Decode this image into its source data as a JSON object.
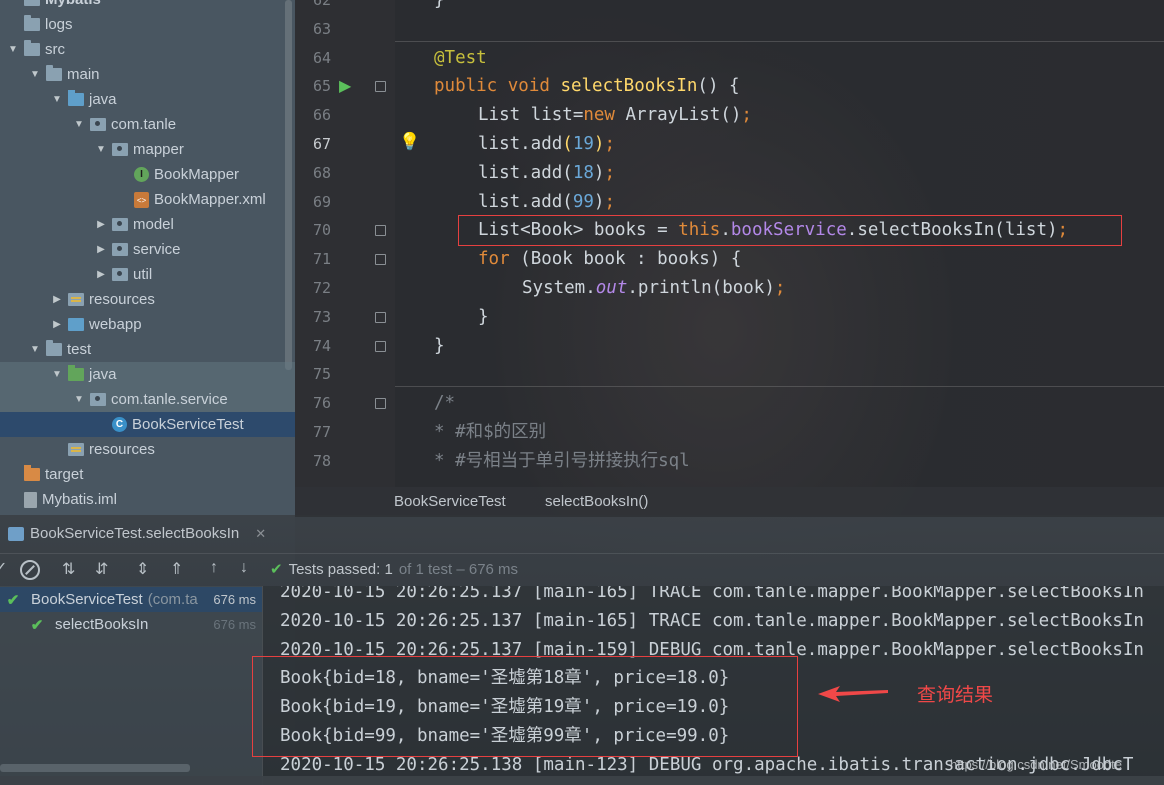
{
  "project_tree": {
    "items": [
      {
        "label": "Mybatis",
        "depth": 0,
        "icon": "folder",
        "arrow": "",
        "bold": true
      },
      {
        "label": "logs",
        "depth": 0,
        "icon": "folder",
        "arrow": ""
      },
      {
        "label": "src",
        "depth": 0,
        "icon": "folder",
        "arrow": "▼"
      },
      {
        "label": "main",
        "depth": 1,
        "icon": "folder",
        "arrow": "▼"
      },
      {
        "label": "java",
        "depth": 2,
        "icon": "src",
        "arrow": "▼"
      },
      {
        "label": "com.tanle",
        "depth": 3,
        "icon": "pkg",
        "arrow": "▼"
      },
      {
        "label": "mapper",
        "depth": 4,
        "icon": "pkg",
        "arrow": "▼"
      },
      {
        "label": "BookMapper",
        "depth": 5,
        "icon": "iface",
        "arrow": ""
      },
      {
        "label": "BookMapper.xml",
        "depth": 5,
        "icon": "xml",
        "arrow": ""
      },
      {
        "label": "model",
        "depth": 4,
        "icon": "pkg",
        "arrow": "▶"
      },
      {
        "label": "service",
        "depth": 4,
        "icon": "pkg",
        "arrow": "▶"
      },
      {
        "label": "util",
        "depth": 4,
        "icon": "pkg",
        "arrow": "▶"
      },
      {
        "label": "resources",
        "depth": 2,
        "icon": "res",
        "arrow": "▶"
      },
      {
        "label": "webapp",
        "depth": 2,
        "icon": "web",
        "arrow": "▶"
      },
      {
        "label": "test",
        "depth": 1,
        "icon": "folder",
        "arrow": "▼"
      },
      {
        "label": "java",
        "depth": 2,
        "icon": "test",
        "arrow": "▼"
      },
      {
        "label": "com.tanle.service",
        "depth": 3,
        "icon": "pkg",
        "arrow": "▼"
      },
      {
        "label": "BookServiceTest",
        "depth": 4,
        "icon": "testclass",
        "arrow": "",
        "selected": true
      },
      {
        "label": "resources",
        "depth": 2,
        "icon": "res",
        "arrow": ""
      },
      {
        "label": "target",
        "depth": 0,
        "icon": "target",
        "arrow": ""
      },
      {
        "label": "Mybatis.iml",
        "depth": 0,
        "icon": "iml",
        "arrow": ""
      }
    ]
  },
  "editor": {
    "lines": [
      {
        "no": "62",
        "html": "}",
        "indent": 0
      },
      {
        "no": "63",
        "html": "",
        "indent": 0
      },
      {
        "no": "64",
        "html": "<span class=\"ann\">@Test</span>",
        "indent": 0
      },
      {
        "no": "65",
        "html": "<span class=\"kw\">public void </span><span class=\"fn\">selectBooksIn</span>() {",
        "indent": 0
      },
      {
        "no": "66",
        "html": "List list=<span class=\"kw\">new </span>ArrayList()<span class=\"kw\">;</span>",
        "indent": 1
      },
      {
        "no": "67",
        "html": "list.add<span class=\"fn\">(</span><span class=\"num\">19</span><span class=\"fn\">)</span><span class=\"kw\">;</span>",
        "indent": 1
      },
      {
        "no": "68",
        "html": "list.add(<span class=\"num\">18</span>)<span class=\"kw\">;</span>",
        "indent": 1
      },
      {
        "no": "69",
        "html": "list.add(<span class=\"num\">99</span>)<span class=\"kw\">;</span>",
        "indent": 1
      },
      {
        "no": "70",
        "html": "List&lt;Book&gt; books = <span class=\"kw\">this</span>.<span class=\"fld\">bookService</span>.selectBooksIn(list)<span class=\"kw\">;</span>",
        "indent": 1
      },
      {
        "no": "71",
        "html": "<span class=\"kw\">for </span>(Book book : books) {",
        "indent": 1
      },
      {
        "no": "72",
        "html": "System.<span class=\"ital\">out</span>.println(book)<span class=\"kw\">;</span>",
        "indent": 2
      },
      {
        "no": "73",
        "html": "}",
        "indent": 1
      },
      {
        "no": "74",
        "html": "}",
        "indent": 0
      },
      {
        "no": "75",
        "html": "",
        "indent": 0
      },
      {
        "no": "76",
        "html": "<span class=\"cmt\">/*</span>",
        "indent": 0
      },
      {
        "no": "77",
        "html": "<span class=\"cmt\">* #和$的区别</span>",
        "indent": 0
      },
      {
        "no": "78",
        "html": "<span class=\"cmt\">* #号相当于单引号拼接执行sql</span>",
        "indent": 0
      }
    ]
  },
  "breadcrumb": {
    "class_name": "BookServiceTest",
    "method_name": "selectBooksIn()"
  },
  "run_window": {
    "tab_label": "BookServiceTest.selectBooksIn",
    "tests_passed": "Tests passed: 1",
    "tests_detail": "of 1 test – 676 ms",
    "tests": [
      {
        "name": "BookServiceTest",
        "pkg": "(com.ta",
        "time": "676 ms",
        "depth": 0,
        "selected": true
      },
      {
        "name": "selectBooksIn",
        "pkg": "",
        "time": "676 ms",
        "depth": 1,
        "selected": false
      }
    ]
  },
  "console": {
    "lines": [
      "2020-10-15 20:26:25.137 [main-165] TRACE com.tanle.mapper.BookMapper.selectBooksIn",
      "2020-10-15 20:26:25.137 [main-165] TRACE com.tanle.mapper.BookMapper.selectBooksIn",
      "2020-10-15 20:26:25.137 [main-159] DEBUG com.tanle.mapper.BookMapper.selectBooksIn",
      "Book{bid=18, bname='圣墟第18章', price=18.0}",
      "Book{bid=19, bname='圣墟第19章', price=19.0}",
      "Book{bid=99, bname='圣墟第99章', price=99.0}",
      "2020-10-15 20:26:25.138 [main-123] DEBUG org.apache.ibatis.transaction.jdbc.JdbcT"
    ]
  },
  "annotation": {
    "label": "查询结果",
    "color": "#f04848"
  },
  "watermark": "https://blog.csdn.net/Smoodte"
}
